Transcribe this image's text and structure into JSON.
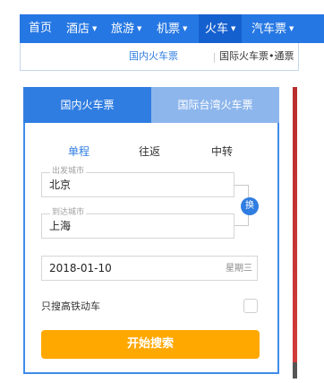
{
  "nav": {
    "items": [
      {
        "label": "首页"
      },
      {
        "label": "酒店",
        "has_menu": true
      },
      {
        "label": "旅游",
        "has_menu": true
      },
      {
        "label": "机票",
        "has_menu": true
      },
      {
        "label": "火车",
        "has_menu": true,
        "active": true
      },
      {
        "label": "汽车票",
        "has_menu": true
      }
    ],
    "caret_glyph": "▼"
  },
  "subnav": {
    "domestic_label": "国内火车票",
    "international_label": "国际火车票•通票"
  },
  "tabs": {
    "domestic": "国内火车票",
    "taiwan": "国际台湾火车票"
  },
  "trip_type": {
    "options": [
      "单程",
      "往返",
      "中转"
    ],
    "selected": "单程"
  },
  "from_city": {
    "label": "出发城市",
    "value": "北京"
  },
  "to_city": {
    "label": "到达城市",
    "value": "上海"
  },
  "swap_label": "换",
  "date": {
    "value": "2018-01-10",
    "weekday": "星期三"
  },
  "high_speed": {
    "label": "只搜高铁动车",
    "checked": false
  },
  "search_button": "开始搜索",
  "colors": {
    "nav_bg": "#2577e3",
    "nav_active": "#1560cf",
    "tab_active": "#2f7de1",
    "tab_inactive": "#8db6ec",
    "trip_selected": "#2f7de1",
    "search_button": "#ffa800",
    "subnav_link": "#2f7de1"
  }
}
